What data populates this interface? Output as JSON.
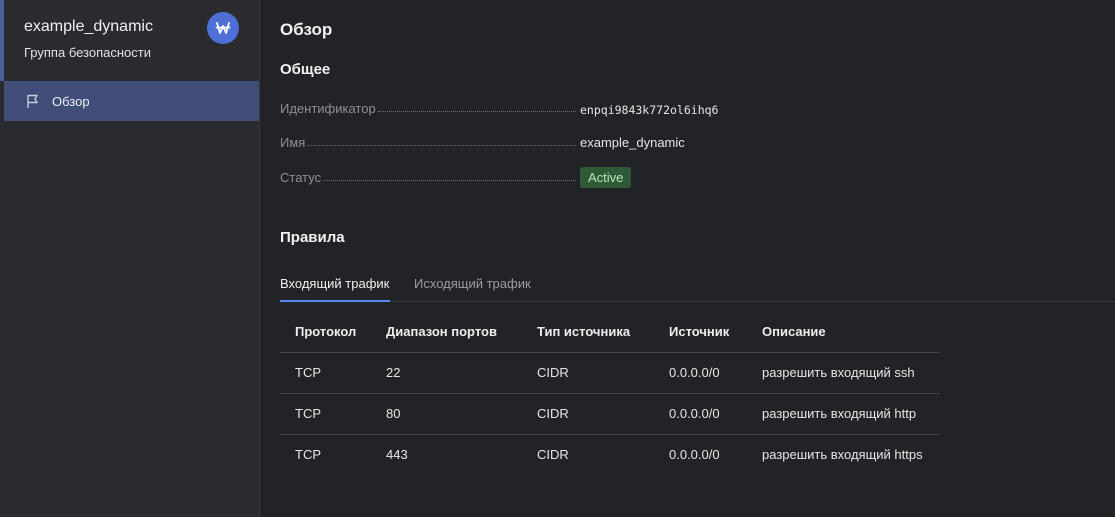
{
  "sidebar": {
    "title": "example_dynamic",
    "subtitle": "Группа безопасности",
    "service_icon": "vpc-network-icon",
    "items": [
      {
        "label": "Обзор",
        "icon": "flag-icon"
      }
    ]
  },
  "main": {
    "page_title": "Обзор",
    "general": {
      "title": "Общее",
      "properties": [
        {
          "label": "Идентификатор",
          "value": "enpqi9843k772ol6ihq6"
        },
        {
          "label": "Имя",
          "value": "example_dynamic"
        },
        {
          "label": "Статус",
          "value": "Active"
        }
      ]
    },
    "rules": {
      "title": "Правила",
      "tabs": [
        {
          "label": "Входящий трафик",
          "active": true
        },
        {
          "label": "Исходящий трафик",
          "active": false
        }
      ],
      "columns": [
        "Протокол",
        "Диапазон портов",
        "Тип источника",
        "Источник",
        "Описание"
      ],
      "rows": [
        [
          "TCP",
          "22",
          "CIDR",
          "0.0.0.0/0",
          "разрешить входящий ssh"
        ],
        [
          "TCP",
          "80",
          "CIDR",
          "0.0.0.0/0",
          "разрешить входящий http"
        ],
        [
          "TCP",
          "443",
          "CIDR",
          "0.0.0.0/0",
          "разрешить входящий https"
        ]
      ]
    }
  },
  "colors": {
    "accent": "#5b87f0",
    "active_sidebar": "#3f4d78",
    "status_badge_bg": "#2f5a37",
    "status_badge_text": "#b6e8b0"
  }
}
